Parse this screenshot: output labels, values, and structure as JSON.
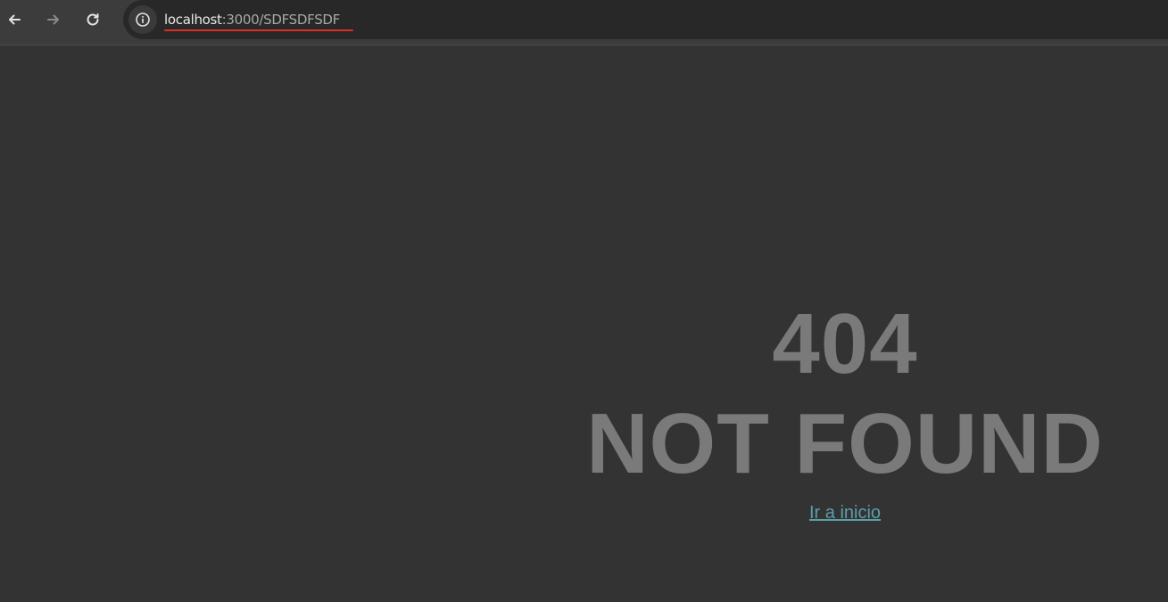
{
  "browser": {
    "back_icon": "arrow-left-icon",
    "forward_icon": "arrow-right-icon",
    "reload_icon": "reload-icon",
    "site_info_icon": "info-icon",
    "url_host": "localhost",
    "url_rest": ":3000/SDFSDFSDF"
  },
  "page": {
    "code": "404",
    "message": "NOT FOUND",
    "home_link": "Ir a inicio"
  },
  "colors": {
    "page_background": "#333333",
    "heading": "#7a7a7a",
    "link": "#5c9ea8",
    "url_underline": "#d93025"
  }
}
